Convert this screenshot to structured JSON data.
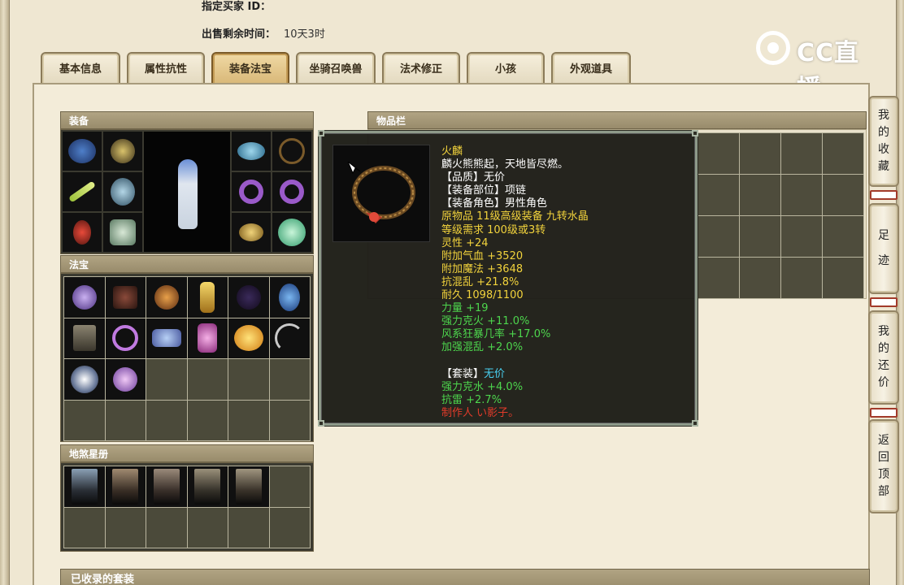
{
  "seller": {
    "designated_buyer_label": "指定买家 ID：",
    "time_left_label": "出售剩余时间：",
    "time_left_value": "10天3时"
  },
  "logo": {
    "text": "CC直播"
  },
  "tabs": [
    {
      "label": "基本信息"
    },
    {
      "label": "属性抗性"
    },
    {
      "label": "装备法宝"
    },
    {
      "label": "坐骑召唤兽"
    },
    {
      "label": "法术修正"
    },
    {
      "label": "小孩"
    },
    {
      "label": "外观道具"
    }
  ],
  "panels": {
    "equipment": "装备",
    "treasure": "法宝",
    "star_book": "地煞星册",
    "inventory": "物品栏",
    "collected_sets": "已收录的套装"
  },
  "tooltip": {
    "name": "火麟",
    "desc": "麟火熊熊起，天地皆尽燃。",
    "quality": "【品质】无价",
    "slot": "【装备部位】项链",
    "role": "【装备角色】男性角色",
    "origin": "原物品 11级高级装备 九转水晶",
    "level_req": "等级需求 100级或3转",
    "stat_lingxing": "灵性 +24",
    "stat_hp": "附加气血 +3520",
    "stat_mp": "附加魔法 +3648",
    "stat_chaos": "抗混乱 +21.8%",
    "durability": "耐久 1098/1100",
    "bonus_strength": "力量 +19",
    "bonus_fire": "强力克火 +11.0%",
    "bonus_wind": "风系狂暴几率 +17.0%",
    "bonus_chaos": "加强混乱 +2.0%",
    "set_label": "【套装】",
    "set_value": "无价",
    "set_water": "强力克水 +4.0%",
    "set_thunder": "抗雷 +2.7%",
    "maker": "制作人 い影子。"
  },
  "side_buttons": [
    {
      "label": [
        "我",
        "的",
        "收",
        "藏"
      ]
    },
    {
      "label": [
        "足",
        "迹"
      ]
    },
    {
      "label": [
        "我",
        "的",
        "还",
        "价"
      ]
    },
    {
      "label": [
        "返",
        "回",
        "顶",
        "部"
      ]
    }
  ]
}
